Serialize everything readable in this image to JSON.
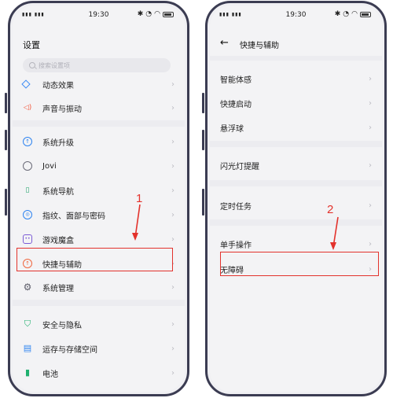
{
  "status_bar": {
    "time": "19:30"
  },
  "left": {
    "title": "设置",
    "search_placeholder": "搜索设置项",
    "items": [
      {
        "label": "动态效果",
        "icon": "diamond-icon"
      },
      {
        "label": "声音与振动",
        "icon": "speaker-icon"
      },
      {
        "label": "系统升级",
        "icon": "upgrade-icon"
      },
      {
        "label": "Jovi",
        "icon": "jovi-icon"
      },
      {
        "label": "系统导航",
        "icon": "navigation-icon"
      },
      {
        "label": "指纹、面部与密码",
        "icon": "fingerprint-icon"
      },
      {
        "label": "游戏魔盒",
        "icon": "game-box-icon"
      },
      {
        "label": "快捷与辅助",
        "icon": "shortcut-assist-icon"
      },
      {
        "label": "系统管理",
        "icon": "gear-icon"
      },
      {
        "label": "安全与隐私",
        "icon": "shield-icon"
      },
      {
        "label": "运存与存储空间",
        "icon": "storage-icon"
      },
      {
        "label": "电池",
        "icon": "battery-icon"
      }
    ],
    "annotation": "1"
  },
  "right": {
    "title": "快捷与辅助",
    "items": [
      {
        "label": "智能体感"
      },
      {
        "label": "快捷启动"
      },
      {
        "label": "悬浮球"
      },
      {
        "label": "闪光灯提醒"
      },
      {
        "label": "定时任务"
      },
      {
        "label": "单手操作"
      },
      {
        "label": "无障碍"
      }
    ],
    "annotation": "2"
  },
  "colors": {
    "highlight": "#e3322c",
    "frame": "#3b3c52"
  }
}
